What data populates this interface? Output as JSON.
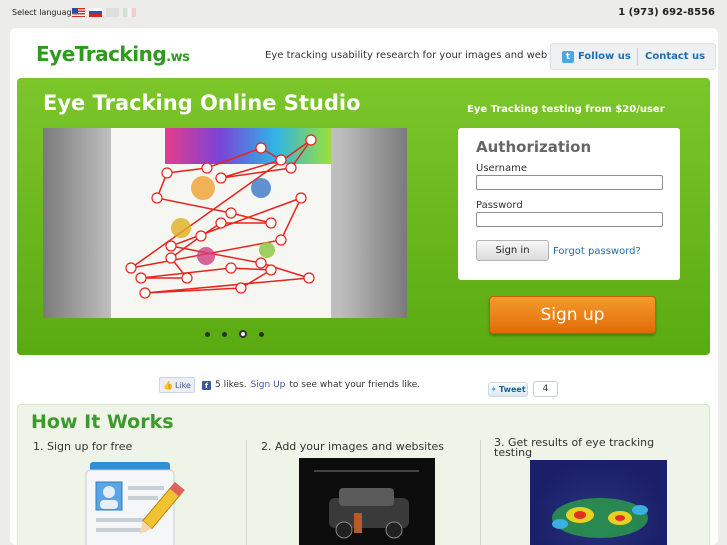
{
  "topbar": {
    "select_language_label": "Select language",
    "languages": [
      "English",
      "Russian",
      "English (UK)",
      "Italian"
    ],
    "phone": "1 (973) 692-8556"
  },
  "header": {
    "logo_main": "EyeTracking",
    "logo_suffix": ".ws",
    "tagline": "Eye tracking usability research for your images and web",
    "follow_us": "Follow us",
    "contact_us": "Contact us"
  },
  "hero": {
    "title": "Eye Tracking Online Studio",
    "promo": "Eye Tracking testing from $20/user",
    "slider": {
      "slides": 4,
      "active_slide": 3
    },
    "auth": {
      "title": "Authorization",
      "username_label": "Username",
      "username_value": "",
      "password_label": "Password",
      "password_value": "",
      "sign_in": "Sign in",
      "forgot_password": "Forgot password?"
    },
    "sign_up": "Sign up"
  },
  "social_counters": {
    "like_label": "Like",
    "likes_text": "5 likes.",
    "sign_up_link": "Sign Up",
    "likes_suffix": "to see what your friends like.",
    "tweet_label": "Tweet",
    "tweet_count": "4"
  },
  "how_it_works": {
    "title": "How It Works",
    "steps": [
      {
        "title": "1. Sign up for free"
      },
      {
        "title": "2. Add your images and websites"
      },
      {
        "title": "3. Get results of eye tracking testing"
      }
    ]
  },
  "colors": {
    "brand_green": "#2e9a1e",
    "hero_green": "#6cb81e",
    "signup_orange": "#ee8418",
    "link_blue": "#1f6fb5"
  }
}
